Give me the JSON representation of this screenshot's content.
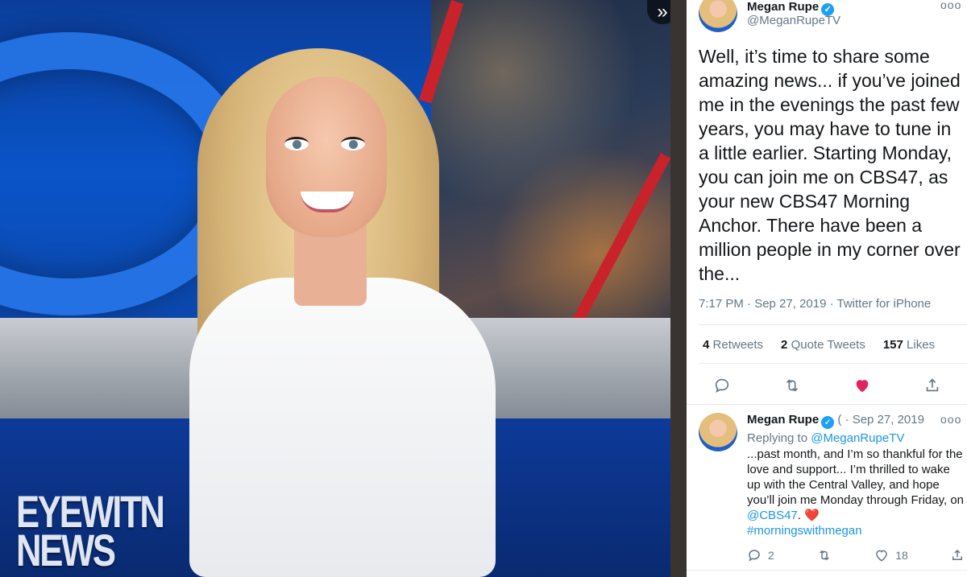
{
  "media": {
    "logo_line1": "EYEWITN",
    "logo_line2": "NEWS",
    "expand_glyph": "»"
  },
  "tweet": {
    "author_name": "Megan Rupe",
    "author_handle": "@MeganRupeTV",
    "verified_glyph": "✓",
    "more_glyph": "ooo",
    "text": "Well, it’s time to share some amazing news... if you’ve joined me in the evenings the past few years, you may have to tune in a little earlier. Starting Monday, you can join me on CBS47, as your new CBS47 Morning Anchor. There have been a million people in my corner over the...",
    "meta": "7:17 PM · Sep 27, 2019 · Twitter for iPhone",
    "stats": {
      "retweets_count": "4",
      "retweets_label": "Retweets",
      "quotes_count": "2",
      "quotes_label": "Quote Tweets",
      "likes_count": "157",
      "likes_label": "Likes"
    },
    "icons": [
      "reply-icon",
      "retweet-icon",
      "like-icon",
      "share-icon"
    ],
    "like_color": "#e0245e",
    "accent_color": "#1b95e0"
  },
  "reply": {
    "author_name": "Megan Rupe",
    "handle_fragment": "(",
    "date": "· Sep 27, 2019",
    "replying_to_label": "Replying to",
    "replying_to_handle": "@MeganRupeTV",
    "text_before_link": "...past month, and I’m so thankful for the love and support... I’m thrilled to wake up with the Central Valley, and hope you’ll join me Monday through Friday, on",
    "mention": "@CBS47",
    "text_after_link": ".",
    "heart_emoji": "❤️",
    "hashtag": "#morningswithmegan",
    "reply_count": "2",
    "like_count": "18"
  }
}
